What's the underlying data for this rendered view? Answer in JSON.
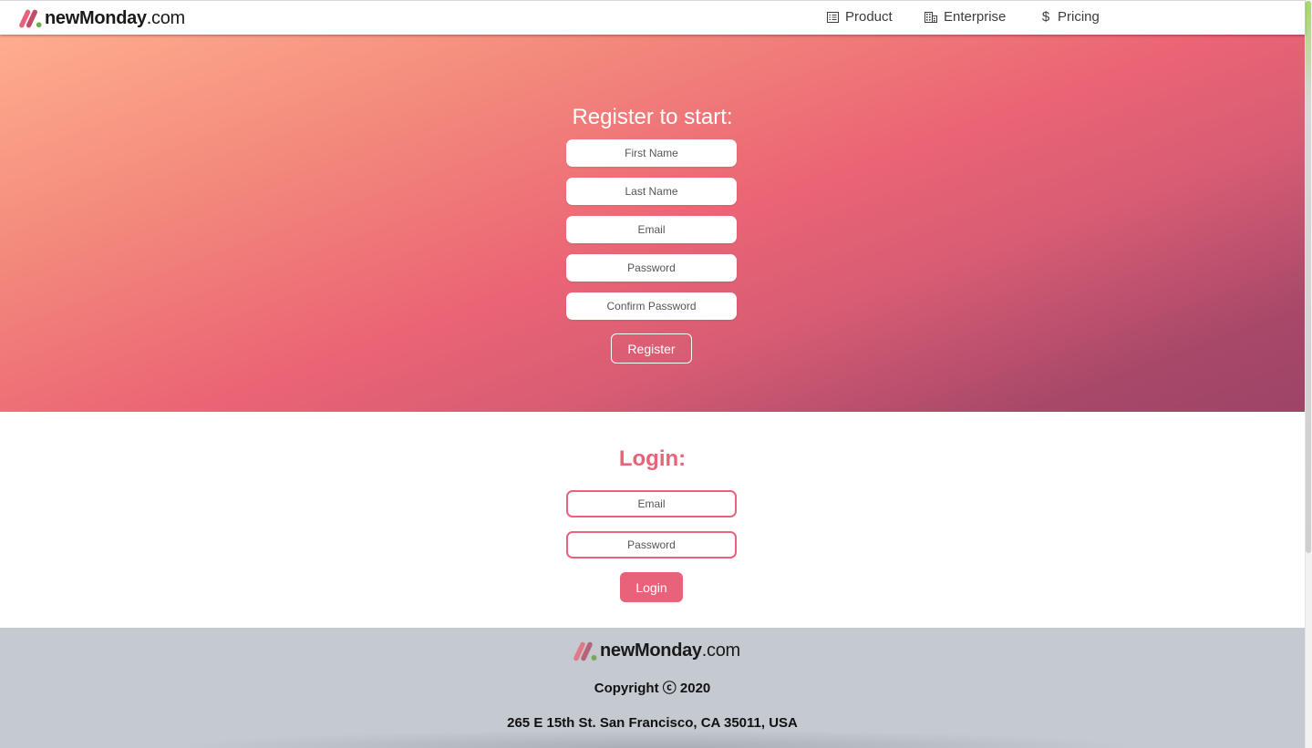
{
  "brand": {
    "name_bold": "newMonday",
    "name_suffix": ".com"
  },
  "nav": {
    "items": [
      {
        "label": "Product",
        "icon": "list-icon"
      },
      {
        "label": "Enterprise",
        "icon": "building-icon"
      },
      {
        "label": "Pricing",
        "icon": "dollar-icon",
        "glyph": "$"
      }
    ]
  },
  "register": {
    "title": "Register to start:",
    "fields": [
      {
        "placeholder": "First Name"
      },
      {
        "placeholder": "Last Name"
      },
      {
        "placeholder": "Email"
      },
      {
        "placeholder": "Password"
      },
      {
        "placeholder": "Confirm Password"
      }
    ],
    "button_label": "Register"
  },
  "login": {
    "title": "Login:",
    "fields": [
      {
        "placeholder": "Email"
      },
      {
        "placeholder": "Password"
      }
    ],
    "button_label": "Login"
  },
  "footer": {
    "copyright": "Copyright ⓒ 2020",
    "address": "265 E 15th St. San Francisco, CA 35011, USA"
  },
  "colors": {
    "accent": "#e8637a",
    "gradient_start": "#ffad8f",
    "gradient_mid": "#eb6475",
    "gradient_end": "#9d4468",
    "footer_bg": "#c5c9d0",
    "logo_green": "#6ab04c"
  }
}
